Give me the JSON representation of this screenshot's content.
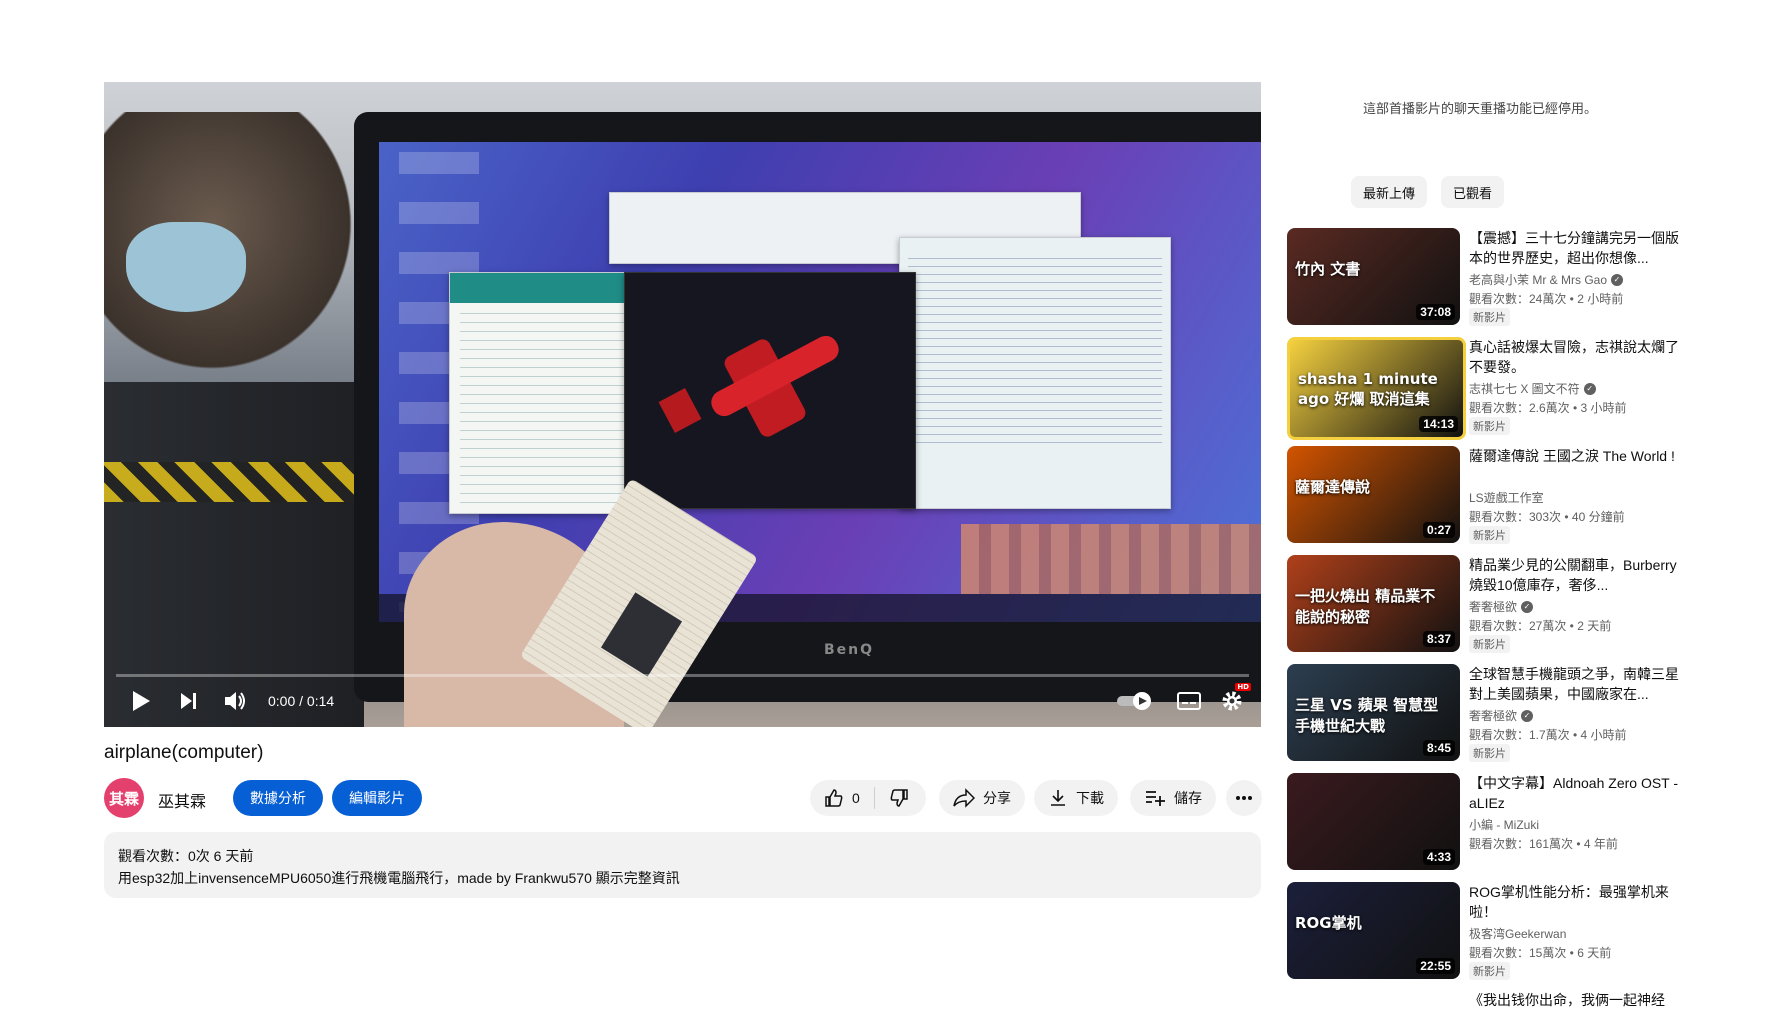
{
  "player": {
    "time": "0:00 / 0:14",
    "progress": 0,
    "brand": "BenQ",
    "hd_badge": "HD"
  },
  "video": {
    "title": "airplane(computer)",
    "channel": "巫其霖",
    "avatar_text": "其霖",
    "analytics_label": "數據分析",
    "edit_label": "編輯影片",
    "like_count": "0",
    "share_label": "分享",
    "download_label": "下載",
    "save_label": "儲存",
    "description": {
      "stats": "觀看次數：0次  6 天前",
      "text": "用esp32加上invensenceMPU6050進行飛機電腦飛行，made by Frankwu570 顯示完整資訊"
    }
  },
  "sidebar": {
    "chat_replay_note": "這部首播影片的聊天重播功能已經停用。",
    "chips": [
      "最新上傳",
      "已觀看"
    ],
    "recommendations": [
      {
        "title": "【震撼】三十七分鐘講完另一個版本的世界歷史，超出你想像...",
        "channel": "老高與小茉 Mr & Mrs Gao",
        "verified": true,
        "meta": "觀看次數：24萬次 • 2 小時前",
        "badge": "新影片",
        "duration": "37:08",
        "thumb_text": "竹內 文書",
        "thumb_bg": "#5a2a22"
      },
      {
        "title": "真心話被爆太冒險，志祺說太爛了不要發。",
        "channel": "志祺七七 X 圖文不符",
        "verified": true,
        "meta": "觀看次數：2.6萬次 • 3 小時前",
        "badge": "新影片",
        "duration": "14:13",
        "thumb_text": "shasha 1 minute ago 好爛 取消這集",
        "thumb_bg": "#f4d03f"
      },
      {
        "title": "薩爾達傳說 王國之淚 The World !",
        "channel": "LS遊戲工作室",
        "verified": false,
        "meta": "觀看次數：303次 • 40 分鐘前",
        "badge": "新影片",
        "duration": "0:27",
        "thumb_text": "薩爾達傳說",
        "thumb_bg": "#d35400"
      },
      {
        "title": "精品業少見的公關翻車，Burberry燒毀10億庫存，奢侈...",
        "channel": "奢奢極欲",
        "verified": true,
        "meta": "觀看次數：27萬次 • 2 天前",
        "badge": "新影片",
        "duration": "8:37",
        "thumb_text": "一把火燒出 精品業不能說的秘密",
        "thumb_bg": "#b0401a"
      },
      {
        "title": "全球智慧手機龍頭之爭，南韓三星對上美國蘋果，中國廠家在...",
        "channel": "奢奢極欲",
        "verified": true,
        "meta": "觀看次數：1.7萬次 • 4 小時前",
        "badge": "新影片",
        "duration": "8:45",
        "thumb_text": "三星 VS 蘋果 智慧型手機世紀大戰",
        "thumb_bg": "#2c3e50"
      },
      {
        "title": "【中文字幕】Aldnoah Zero OST - aLIEz",
        "channel": "小編 - MiZuki",
        "verified": false,
        "meta": "觀看次數：161萬次 • 4 年前",
        "badge": "",
        "duration": "4:33",
        "thumb_text": "",
        "thumb_bg": "#3a1a1e"
      },
      {
        "title": "ROG掌机性能分析：最强掌机来啦！",
        "channel": "极客湾Geekerwan",
        "verified": false,
        "meta": "觀看次數：15萬次 • 6 天前",
        "badge": "新影片",
        "duration": "22:55",
        "thumb_text": "ROG掌机",
        "thumb_bg": "#1b1f3a"
      }
    ],
    "partial_title": "《我出钱你出命，我俩一起神经"
  },
  "colors": {
    "accent_blue": "#065fd4",
    "progress_red": "#ff0000",
    "avatar_pink": "#e4406e"
  }
}
